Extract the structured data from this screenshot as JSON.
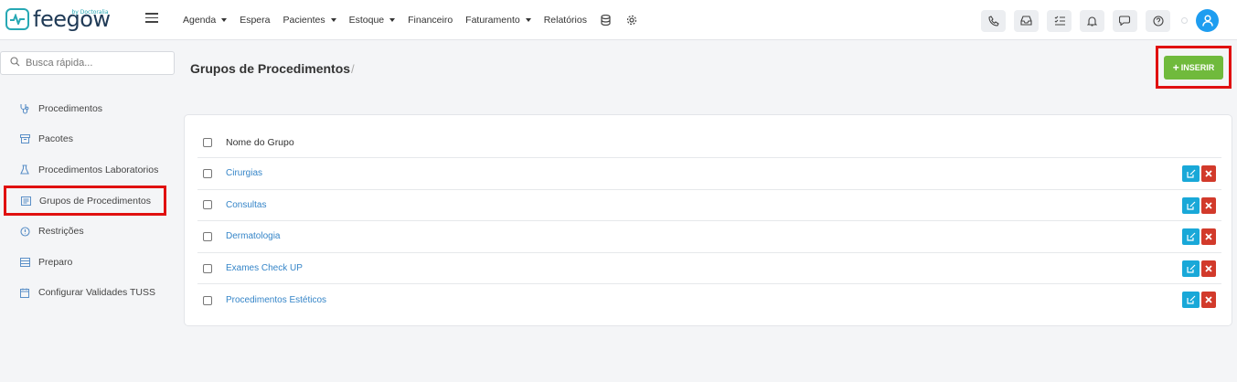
{
  "brand": {
    "name": "feegow",
    "by": "by Doctoralia"
  },
  "nav": {
    "items": [
      {
        "label": "Agenda",
        "dropdown": true
      },
      {
        "label": "Espera",
        "dropdown": false
      },
      {
        "label": "Pacientes",
        "dropdown": true
      },
      {
        "label": "Estoque",
        "dropdown": true
      },
      {
        "label": "Financeiro",
        "dropdown": false
      },
      {
        "label": "Faturamento",
        "dropdown": true
      },
      {
        "label": "Relatórios",
        "dropdown": false
      }
    ],
    "extra_icons": [
      "database-icon",
      "gear-icon"
    ],
    "action_icons": [
      "phone-icon",
      "inbox-icon",
      "checklist-icon",
      "bell-icon",
      "chat-icon",
      "help-icon"
    ]
  },
  "search": {
    "placeholder": "Busca rápida..."
  },
  "sidebar": {
    "items": [
      {
        "label": "Procedimentos",
        "icon": "stethoscope-icon"
      },
      {
        "label": "Pacotes",
        "icon": "archive-icon"
      },
      {
        "label": "Procedimentos Laboratorios",
        "icon": "flask-icon"
      },
      {
        "label": "Grupos de Procedimentos",
        "icon": "group-icon",
        "active": true
      },
      {
        "label": "Restrições",
        "icon": "info-icon"
      },
      {
        "label": "Preparo",
        "icon": "list-icon"
      },
      {
        "label": "Configurar Validades TUSS",
        "icon": "calendar-icon"
      }
    ]
  },
  "header": {
    "title": "Grupos de Procedimentos",
    "separator": "/",
    "insert_label": "INSERIR"
  },
  "table": {
    "column": "Nome do Grupo",
    "rows": [
      "Cirurgias",
      "Consultas",
      "Dermatologia",
      "Exames Check UP",
      "Procedimentos Estéticos"
    ]
  },
  "colors": {
    "accent": "#27a8b4",
    "insert": "#70ba3c",
    "edit": "#19a8d8",
    "delete": "#d23a2b",
    "highlight": "#e01010",
    "link": "#3585c8"
  }
}
